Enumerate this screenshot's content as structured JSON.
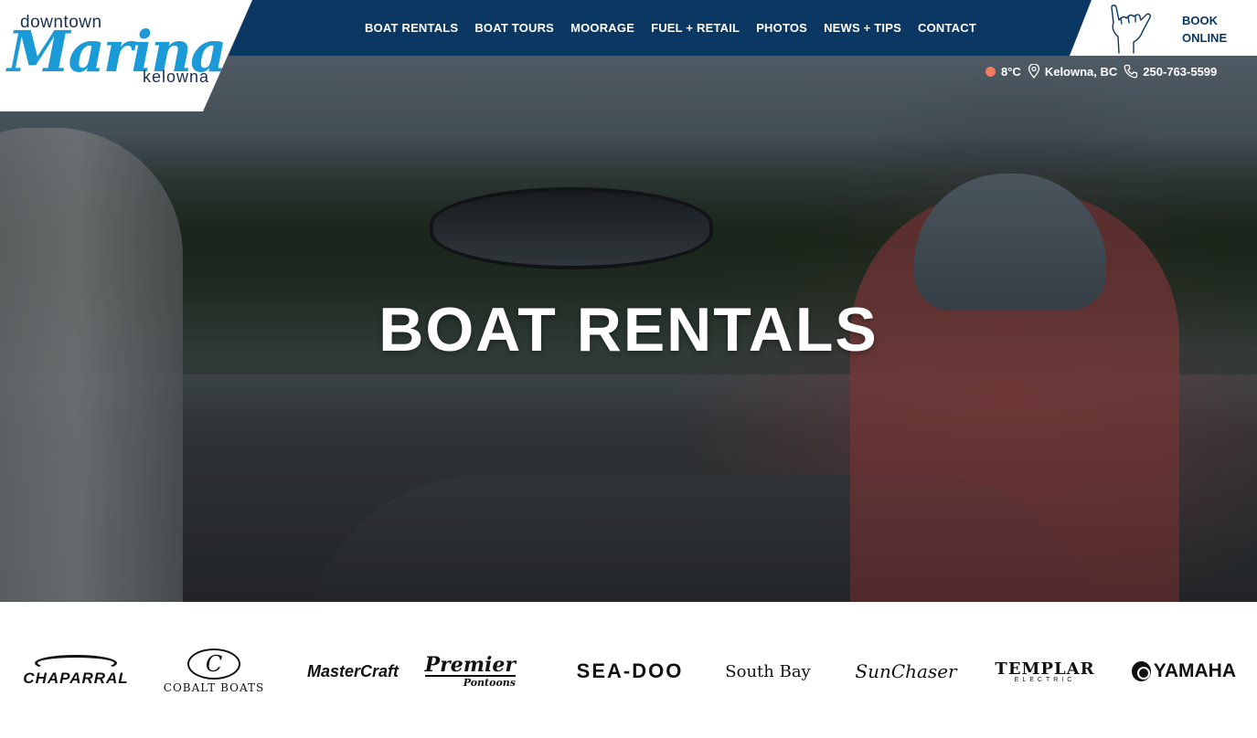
{
  "logo": {
    "top": "downtown",
    "main": "Marina",
    "bottom": "kelowna"
  },
  "nav": {
    "items": [
      "BOAT RENTALS",
      "BOAT TOURS",
      "MOORAGE",
      "FUEL + RETAIL",
      "PHOTOS",
      "NEWS + TIPS",
      "CONTACT"
    ]
  },
  "book": {
    "line1": "BOOK",
    "line2": "ONLINE",
    "icon": "shaka-hand-icon"
  },
  "info": {
    "temperature": "8°C",
    "location": "Kelowna, BC",
    "phone": "250-763-5599",
    "temp_dot_color": "#f07b62"
  },
  "hero": {
    "title": "BOAT RENTALS"
  },
  "brands": {
    "chaparral": "CHAPARRAL",
    "cobalt_seal": "C",
    "cobalt": "COBALT BOATS",
    "mastercraft": "MasterCraft",
    "premier": "Premier",
    "premier_sub": "Pontoons",
    "seadoo": "SEA-DOO",
    "southbay": "South Bay",
    "sunchaser": "SunChaser",
    "templar": "TEMPLAR",
    "templar_sub": "ELECTRIC",
    "yamaha": "YAMAHA"
  },
  "colors": {
    "navy": "#0b3763",
    "brand_blue": "#1a9ad6",
    "white": "#ffffff"
  }
}
